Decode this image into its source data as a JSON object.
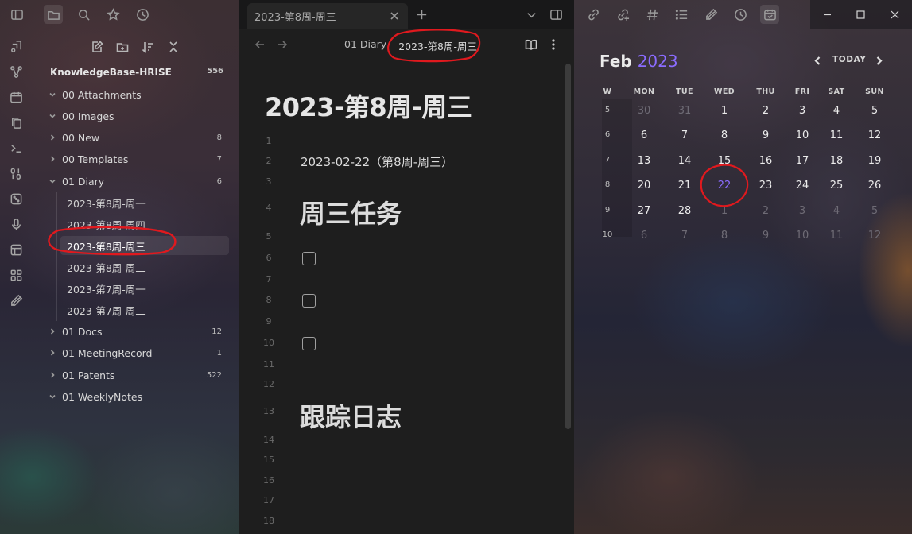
{
  "titlebar": {
    "tab_title": "2023-第8周-周三",
    "left_icons": [
      "sidebar-toggle-icon",
      "folder-icon",
      "search-icon",
      "star-icon",
      "clock-icon"
    ],
    "right_icons": [
      "chevron-down-icon",
      "split-view-icon",
      "link-icon",
      "link-add-icon",
      "hashtag-icon",
      "list-icon",
      "pen-icon",
      "clock-icon",
      "calendar-icon"
    ],
    "window_controls": [
      "minimize-icon",
      "maximize-icon",
      "close-icon"
    ]
  },
  "ribbon": {
    "icons": [
      "graph-link-icon",
      "graph-view-icon",
      "calendar-icon",
      "copy-icon",
      "terminal-icon",
      "binary-icon",
      "dice-icon",
      "microphone-icon",
      "layout-icon",
      "templates-icon",
      "pen-icon"
    ]
  },
  "explorer": {
    "tools": [
      "new-note-icon",
      "new-folder-icon",
      "sort-icon",
      "collapse-icon"
    ],
    "vault_name": "KnowledgeBase-HRISE",
    "vault_count": "556",
    "folders_top": [
      {
        "label": "00 Attachments",
        "count": ""
      },
      {
        "label": "00 Images",
        "count": ""
      },
      {
        "label": "00 New",
        "count": "8"
      },
      {
        "label": "00 Templates",
        "count": "7"
      },
      {
        "label": "01 Diary",
        "count": "6"
      }
    ],
    "diary_files": [
      {
        "label": "2023-第8周-周一"
      },
      {
        "label": "2023-第8周-周四"
      },
      {
        "label": "2023-第8周-周三"
      },
      {
        "label": "2023-第8周-周二"
      },
      {
        "label": "2023-第7周-周一"
      },
      {
        "label": "2023-第7周-周二"
      }
    ],
    "folders_bottom": [
      {
        "label": "01 Docs",
        "count": "12"
      },
      {
        "label": "01 MeetingRecord",
        "count": "1"
      },
      {
        "label": "01 Patents",
        "count": "522"
      },
      {
        "label": "01 WeeklyNotes",
        "count": ""
      }
    ]
  },
  "editor": {
    "breadcrumb_folder": "01 Diary",
    "breadcrumb_note": "2023-第8周-周三",
    "title": "2023-第8周-周三",
    "line_numbers": [
      "1",
      "2",
      "3",
      "4",
      "5",
      "6",
      "7",
      "8",
      "9",
      "10",
      "11",
      "12",
      "13",
      "14",
      "15",
      "16",
      "17",
      "18"
    ],
    "date_line": "2023-02-22（第8周-周三）",
    "heading_tasks": "周三任务",
    "heading_log": "跟踪日志"
  },
  "calendar": {
    "month": "Feb",
    "year": "2023",
    "today_label": "TODAY",
    "headers": [
      "W",
      "MON",
      "TUE",
      "WED",
      "THU",
      "FRI",
      "SAT",
      "SUN"
    ],
    "weeks": [
      {
        "w": "5",
        "days": [
          "30",
          "31",
          "1",
          "2",
          "3",
          "4",
          "5"
        ]
      },
      {
        "w": "6",
        "days": [
          "6",
          "7",
          "8",
          "9",
          "10",
          "11",
          "12"
        ]
      },
      {
        "w": "7",
        "days": [
          "13",
          "14",
          "15",
          "16",
          "17",
          "18",
          "19"
        ]
      },
      {
        "w": "8",
        "days": [
          "20",
          "21",
          "22",
          "23",
          "24",
          "25",
          "26"
        ]
      },
      {
        "w": "9",
        "days": [
          "27",
          "28",
          "1",
          "2",
          "3",
          "4",
          "5"
        ]
      },
      {
        "w": "10",
        "days": [
          "6",
          "7",
          "8",
          "9",
          "10",
          "11",
          "12"
        ]
      }
    ],
    "colors": {
      "accent": "#8b6cff",
      "muted": "#6e6b75",
      "annotation": "#e0191e"
    }
  }
}
